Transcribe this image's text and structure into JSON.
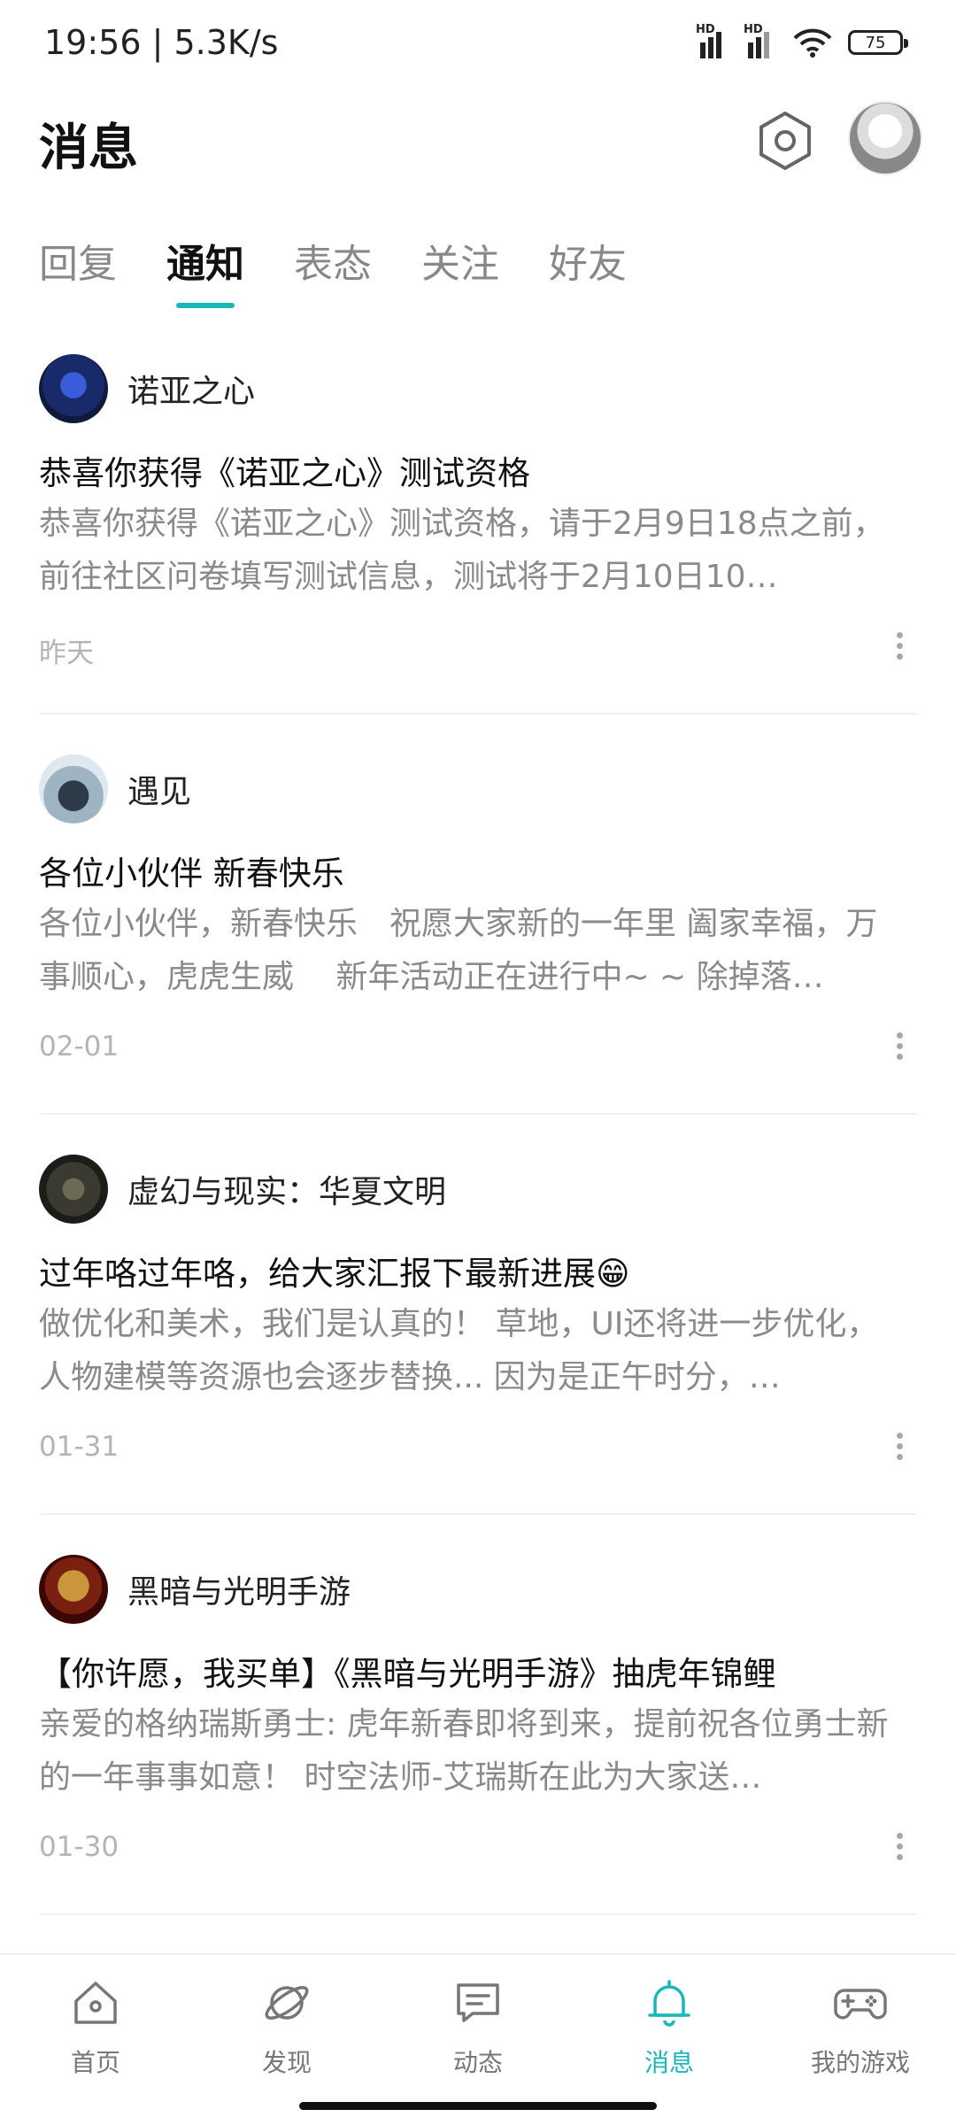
{
  "status_bar": {
    "time": "19:56 | 5.3K/s",
    "signal_1_label": "HD",
    "signal_2_label": "HD",
    "battery": "75"
  },
  "header": {
    "title": "消息",
    "settings_icon": "hexagon-gear-icon",
    "avatar_icon": "user-avatar"
  },
  "tabs": [
    {
      "label": "回复",
      "active": false
    },
    {
      "label": "通知",
      "active": true
    },
    {
      "label": "表态",
      "active": false
    },
    {
      "label": "关注",
      "active": false
    },
    {
      "label": "好友",
      "active": false
    }
  ],
  "notifications": [
    {
      "sender": "诺亚之心",
      "headline": "恭喜你获得《诺亚之心》测试资格",
      "body": "恭喜你获得《诺亚之心》测试资格，请于2月9日18点之前，前往社区问卷填写测试信息，测试将于2月10日10…",
      "date": "昨天",
      "avatar_colors": [
        "#101a3a",
        "#3a5cd8"
      ]
    },
    {
      "sender": "遇见",
      "headline": "各位小伙伴 新春快乐",
      "body": "各位小伙伴，新春快乐　祝愿大家新的一年里 阖家幸福，万事顺心，虎虎生威　 新年活动正在进行中~ ~ 除掉落…",
      "date": "02-01",
      "avatar_colors": [
        "#dfe8ee",
        "#2d3a48"
      ]
    },
    {
      "sender": "虚幻与现实：华夏文明",
      "headline": "过年咯过年咯，给大家汇报下最新进展😁",
      "body": "做优化和美术，我们是认真的！ 草地，UI还将进一步优化，人物建模等资源也会逐步替换... 因为是正午时分，…",
      "date": "01-31",
      "avatar_colors": [
        "#1c1c18",
        "#6b6a55"
      ]
    },
    {
      "sender": "黑暗与光明手游",
      "headline": "【你许愿，我买单】《黑暗与光明手游》抽虎年锦鲤",
      "body": "亲爱的格纳瑞斯勇士: 虎年新春即将到来，提前祝各位勇士新的一年事事如意！ 时空法师-艾瑞斯在此为大家送…",
      "date": "01-30",
      "avatar_colors": [
        "#3a0606",
        "#c9963c"
      ]
    }
  ],
  "bottom_nav": [
    {
      "label": "首页",
      "icon": "home-icon",
      "active": false
    },
    {
      "label": "发现",
      "icon": "planet-icon",
      "active": false
    },
    {
      "label": "动态",
      "icon": "chat-bubble-icon",
      "active": false
    },
    {
      "label": "消息",
      "icon": "bell-icon",
      "active": true
    },
    {
      "label": "我的游戏",
      "icon": "gamepad-icon",
      "active": false
    }
  ],
  "accent_color": "#19b8b8"
}
